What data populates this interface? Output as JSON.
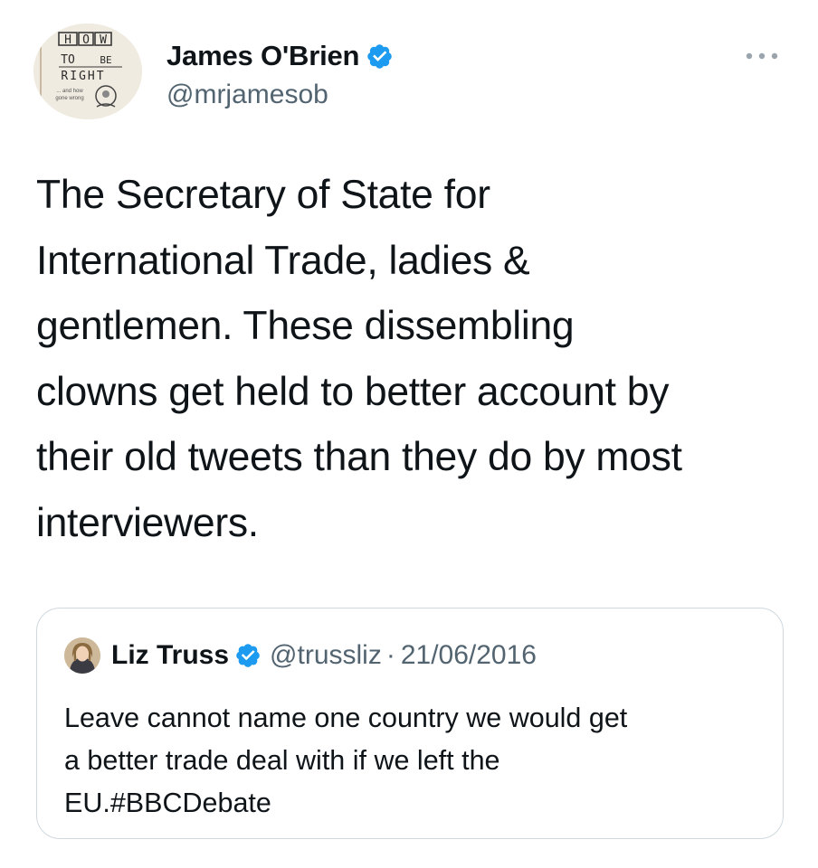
{
  "tweet": {
    "author": {
      "name": "James O'Brien",
      "handle": "@mrjamesob",
      "verified": true,
      "avatar_icon": "book-cover-avatar-icon",
      "avatar_text": "HOW TO BE RIGHT"
    },
    "more_icon": "more-options-icon",
    "text": "The Secretary of State for\nInternational Trade, ladies &\ngentlemen. These dissembling\nclowns get held to better account by\ntheir old tweets than they do by most\ninterviewers.",
    "quoted": {
      "author_name": "Liz Truss",
      "handle": "@trussliz",
      "separator": "·",
      "date": "21/06/2016",
      "verified": true,
      "avatar_icon": "profile-photo-avatar-icon",
      "text": "Leave cannot name one country we would get\na better trade deal with if we left the\nEU.#BBCDebate"
    }
  },
  "colors": {
    "text": "#0f1419",
    "secondary": "#536471",
    "verified_blue": "#1d9bf0",
    "border": "#cfd9de"
  }
}
